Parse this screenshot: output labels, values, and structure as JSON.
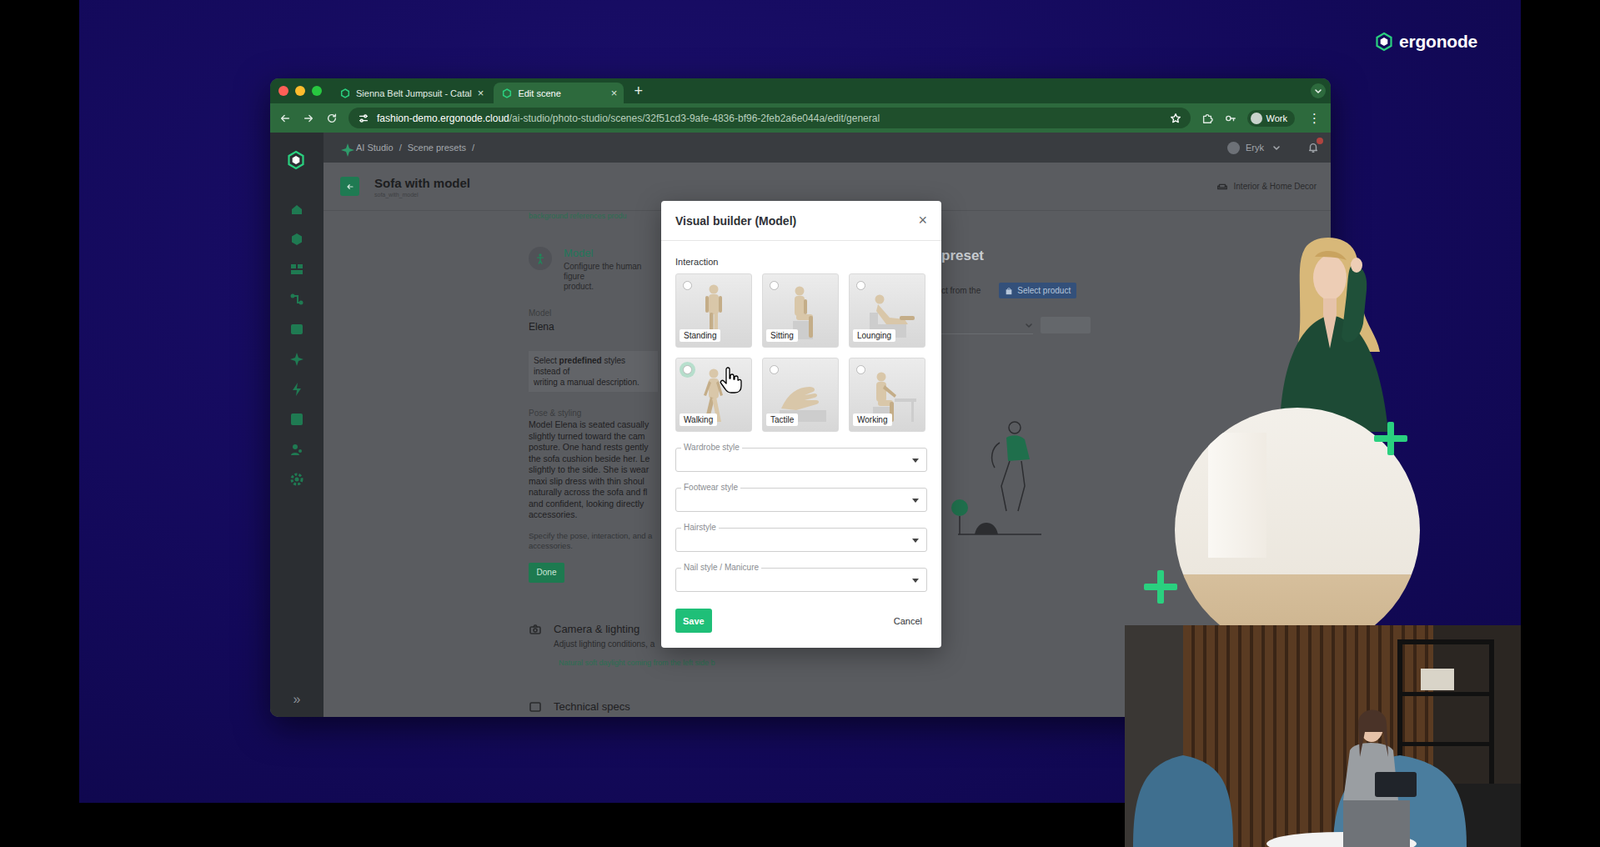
{
  "brand": {
    "name": "ergonode"
  },
  "browser": {
    "tabs": [
      {
        "label": "Sienna Belt Jumpsuit - Catal",
        "close": "×",
        "selected": false
      },
      {
        "label": "Edit scene",
        "close": "×",
        "selected": true
      }
    ],
    "new_tab": "+",
    "address": {
      "host": "fashion-demo.ergonode.cloud",
      "path": "/ai-studio/photo-studio/scenes/32f51cd3-9afe-4836-bf96-2feb2a6e044a/edit/general"
    },
    "profile": "Work",
    "menu": "⋮"
  },
  "app": {
    "breadcrumb": {
      "items": [
        "AI Studio",
        "Scene presets"
      ],
      "separator": "/"
    },
    "user": "Eryk",
    "sidebar": {
      "expand": "»"
    },
    "page": {
      "title": "Sofa with model",
      "code": "sofa_with_model",
      "category": "Interior & Home Decor"
    },
    "scrolled_text": "background references produ",
    "model_section": {
      "title": "Model",
      "description": [
        "Configure the human figure",
        "product."
      ],
      "model_label": "Model",
      "model_value": "Elena",
      "info": {
        "before": "Select ",
        "bold": "predefined",
        "after": " styles instead of",
        "line2": "writing a manual description."
      },
      "pose_label": "Pose & styling",
      "pose_lines": [
        "Model Elena is seated casually",
        "slightly turned toward the cam",
        "posture. One hand rests gently",
        "the sofa cushion beside her. Le",
        "slightly to the side. She is wear",
        "maxi slip dress with thin shoul",
        "naturally across the sofa and fl",
        "and confident, looking directly",
        "accessories."
      ],
      "hint_lines": [
        "Specify the pose, interaction, and a",
        "accessories."
      ],
      "done": "Done"
    },
    "camera_section": {
      "title": "Camera & lighting",
      "description": "Adjust lighting conditions, a",
      "value": "Natural soft daylight coming from the left side b"
    },
    "specs_section": {
      "title": "Technical specs"
    },
    "product_section": {
      "title": "preset",
      "description": "ct from the",
      "button": "Select product"
    }
  },
  "modal": {
    "title": "Visual builder (Model)",
    "close": "×",
    "interaction_label": "Interaction",
    "options": [
      {
        "label": "Standing",
        "kind": "standing",
        "selected": false,
        "hovered": false
      },
      {
        "label": "Sitting",
        "kind": "sitting",
        "selected": false,
        "hovered": false
      },
      {
        "label": "Lounging",
        "kind": "lounging",
        "selected": false,
        "hovered": false
      },
      {
        "label": "Walking",
        "kind": "walking",
        "selected": false,
        "hovered": true
      },
      {
        "label": "Tactile",
        "kind": "tactile",
        "selected": false,
        "hovered": false
      },
      {
        "label": "Working",
        "kind": "working",
        "selected": false,
        "hovered": false
      }
    ],
    "fields": [
      {
        "label": "Wardrobe style",
        "value": ""
      },
      {
        "label": "Footwear style",
        "value": ""
      },
      {
        "label": "Hairstyle",
        "value": ""
      },
      {
        "label": "Nail style / Manicure",
        "value": ""
      }
    ],
    "save": "Save",
    "cancel": "Cancel"
  }
}
